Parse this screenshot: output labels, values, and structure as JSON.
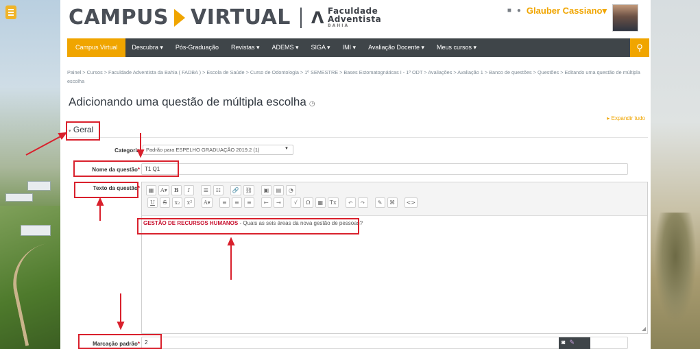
{
  "brand": {
    "title_part1": "CAMPUS",
    "title_part2": "VIRTUAL",
    "institution_line1": "Faculdade",
    "institution_line2": "Adventista",
    "institution_line3": "BAHIA"
  },
  "user": {
    "name": "Glauber Cassiano"
  },
  "nav": {
    "items": [
      {
        "label": "Campus Virtual"
      },
      {
        "label": "Descubra ▾"
      },
      {
        "label": "Pós-Graduação"
      },
      {
        "label": "Revistas ▾"
      },
      {
        "label": "ADEMS ▾"
      },
      {
        "label": "SIGA ▾"
      },
      {
        "label": "IMI ▾"
      },
      {
        "label": "Avaliação Docente ▾"
      },
      {
        "label": "Meus cursos ▾"
      }
    ]
  },
  "breadcrumb": "Painel > Cursos > Faculdade Adventista da Bahia ( FADBA ) > Escola de Saúde > Curso de Odontologia > 1º SEMESTRE > Bases Estomatognáticas I - 1º ODT > Avaliações > Avaliação 1 > Banco de questões > Questões > Editando uma questão de múltipla escolha",
  "page": {
    "title": "Adicionando uma questão de múltipla escolha",
    "expand_all": "Expandir tudo"
  },
  "section": {
    "legend": "Geral"
  },
  "form": {
    "category_label": "Categoria",
    "category_value": "Padrão para ESPELHO GRADUAÇÃO 2019.2 (1)",
    "question_name_label": "Nome da questão",
    "question_name_value": "T1 Q1",
    "question_text_label": "Texto da questão",
    "question_text_topic": "GESTÃO DE RECURSOS HUMANOS",
    "question_text_body": " - Quais as seis áreas da nova gestão de pessoas?",
    "default_mark_label": "Marcação padrão",
    "default_mark_value": "2",
    "required_mark": "*"
  },
  "toolbar": {
    "row1": [
      "▦",
      "A▾",
      "B",
      "I",
      "☰",
      "☷",
      "🔗",
      "⛓",
      "▣",
      "▤",
      "◔"
    ],
    "row2": [
      "U",
      "S",
      "x₂",
      "x²",
      "A▾",
      "≡",
      "≡",
      "≡",
      "⇤",
      "⇥",
      "√",
      "Ω",
      "▦",
      "Tx",
      "↶",
      "↷",
      "✎",
      "⌘",
      "<>"
    ]
  }
}
